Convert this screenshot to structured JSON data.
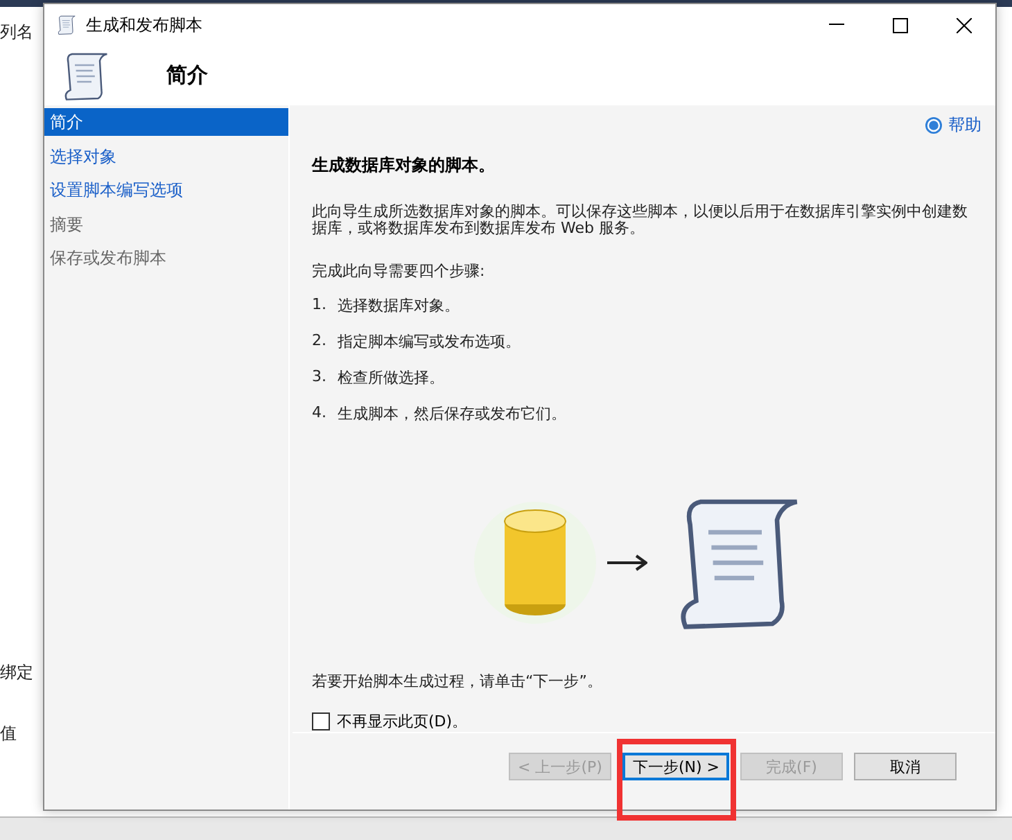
{
  "background": {
    "labels": [
      "列名",
      "绑定",
      "值"
    ]
  },
  "window": {
    "title": "生成和发布脚本"
  },
  "header": {
    "title": "简介"
  },
  "nav": [
    {
      "label": "简介",
      "selected": true,
      "kind": "link"
    },
    {
      "label": "选择对象",
      "selected": false,
      "kind": "link"
    },
    {
      "label": "设置脚本编写选项",
      "selected": false,
      "kind": "link"
    },
    {
      "label": "摘要",
      "selected": false,
      "kind": "plain"
    },
    {
      "label": "保存或发布脚本",
      "selected": false,
      "kind": "plain"
    }
  ],
  "help": "帮助",
  "content": {
    "heading": "生成数据库对象的脚本。",
    "intro": "此向导生成所选数据库对象的脚本。可以保存这些脚本，以便以后用于在数据库引擎实例中创建数据库，或将数据库发布到数据库发布 Web 服务。",
    "steps_title": "完成此向导需要四个步骤:",
    "steps": [
      {
        "number": "1.",
        "text": "选择数据库对象。"
      },
      {
        "number": "2.",
        "text": "指定脚本编写或发布选项。"
      },
      {
        "number": "3.",
        "text": "检查所做选择。"
      },
      {
        "number": "4.",
        "text": "生成脚本，然后保存或发布它们。"
      }
    ],
    "start_hint": "若要开始脚本生成过程，请单击“下一步”。",
    "checkbox": {
      "label": "不再显示此页(D)。",
      "checked": false
    }
  },
  "buttons": [
    {
      "label": "< 上一步(P)",
      "disabled": true,
      "focused": false
    },
    {
      "label": "下一步(N) >",
      "disabled": false,
      "focused": true
    },
    {
      "label": "完成(F)",
      "disabled": true,
      "focused": false
    },
    {
      "label": "取消",
      "disabled": false,
      "focused": false
    }
  ]
}
